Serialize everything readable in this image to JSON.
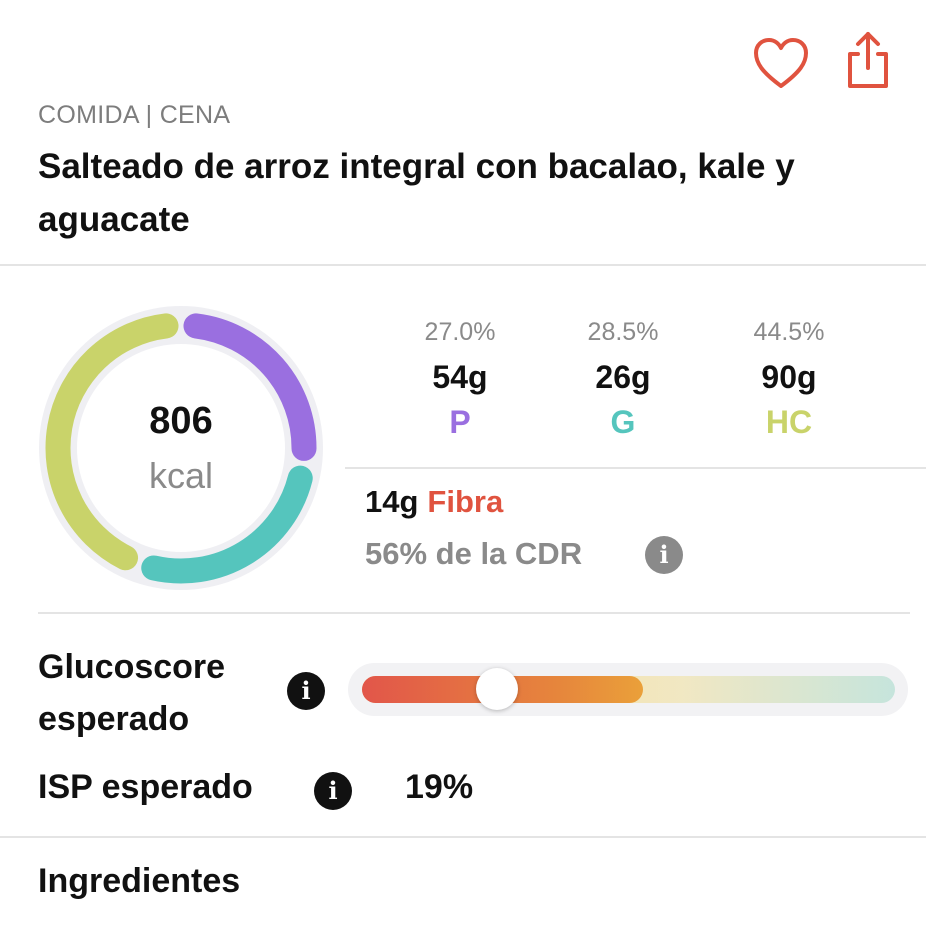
{
  "header": {
    "category": "COMIDA | CENA",
    "title": "Salteado de arroz integral con bacalao, kale y aguacate",
    "favorite_icon": "heart-icon",
    "share_icon": "share-icon",
    "accent_color": "#e0533f"
  },
  "calories": {
    "value": "806",
    "unit": "kcal"
  },
  "ring": {
    "segments": [
      {
        "name": "P",
        "fraction": 0.27,
        "color": "#9a6fe0"
      },
      {
        "name": "G",
        "fraction": 0.285,
        "color": "#55c5bd"
      },
      {
        "name": "HC",
        "fraction": 0.445,
        "color": "#c9d36a"
      }
    ],
    "track_color": "#efeff3"
  },
  "macros": [
    {
      "pct": "27.0%",
      "grams": "54g",
      "abbr": "P",
      "color": "#9a6fe0"
    },
    {
      "pct": "28.5%",
      "grams": "26g",
      "abbr": "G",
      "color": "#55c5bd"
    },
    {
      "pct": "44.5%",
      "grams": "90g",
      "abbr": "HC",
      "color": "#c9d36a"
    }
  ],
  "fiber": {
    "amount": "14g",
    "label": "Fibra",
    "rda": "56% de la CDR",
    "info_icon": "info-icon"
  },
  "glucoscore": {
    "label_line1": "Glucoscore",
    "label_line2": "esperado",
    "info_icon": "info-icon",
    "level": 0.25
  },
  "isp": {
    "label": "ISP esperado",
    "value": "19%",
    "info_icon": "info-icon"
  },
  "ingredients": {
    "label": "Ingredientes"
  }
}
